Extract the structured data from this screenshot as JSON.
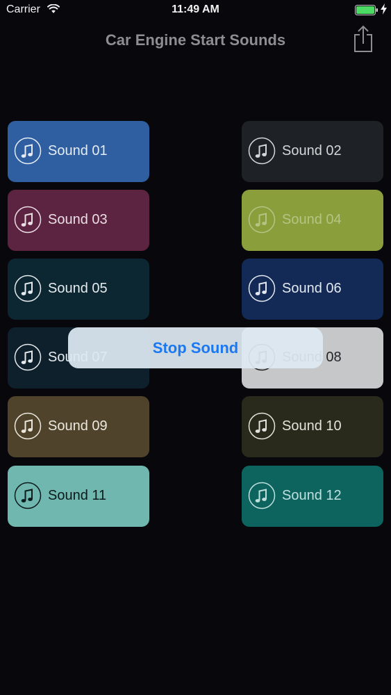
{
  "status_bar": {
    "carrier": "Carrier",
    "time": "11:49 AM",
    "icons": [
      "wifi-icon",
      "battery-icon",
      "charging-icon"
    ],
    "battery_color": "#4cd964"
  },
  "nav": {
    "title": "Car Engine Start Sounds",
    "share_icon": "share-icon"
  },
  "sounds": [
    {
      "label": "Sound 01",
      "color": "#2f5fa0",
      "text_color": "#e6ecf5"
    },
    {
      "label": "Sound 02",
      "color": "#1e2226",
      "text_color": "#d4d7da"
    },
    {
      "label": "Sound 03",
      "color": "#5c2440",
      "text_color": "#ecdee5"
    },
    {
      "label": "Sound 04",
      "color": "#8a9f3b",
      "text_color": "#b5c484"
    },
    {
      "label": "Sound 05",
      "color": "#0c2731",
      "text_color": "#e5ebee"
    },
    {
      "label": "Sound 06",
      "color": "#132a57",
      "text_color": "#e4e8f0"
    },
    {
      "label": "Sound 07",
      "color": "#0e202c",
      "text_color": "#e5eaee"
    },
    {
      "label": "Sound 08",
      "color": "#c6c7c9",
      "text_color": "#222427"
    },
    {
      "label": "Sound 09",
      "color": "#4f432b",
      "text_color": "#ede8de"
    },
    {
      "label": "Sound 10",
      "color": "#292a1c",
      "text_color": "#e3e4dc"
    },
    {
      "label": "Sound 11",
      "color": "#6fb7af",
      "text_color": "#0b1a1a"
    },
    {
      "label": "Sound 12",
      "color": "#0d645f",
      "text_color": "#bfe0dd"
    }
  ],
  "overlay": {
    "stop_label": "Stop Sound",
    "text_color": "#1a78f2"
  }
}
